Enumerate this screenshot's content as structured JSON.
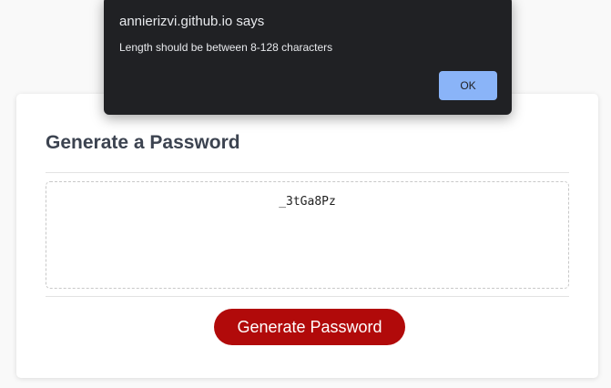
{
  "card": {
    "title": "Generate a Password",
    "password": "_3tGa8Pz",
    "generate_label": "Generate Password"
  },
  "dialog": {
    "title": "annierizvi.github.io says",
    "message": "Length should be between 8-128 characters",
    "ok_label": "OK"
  },
  "colors": {
    "page_background": "#f9f9f9",
    "button_red": "#b10a0a",
    "dialog_background": "#202124",
    "dialog_ok": "#8ab4f8"
  }
}
